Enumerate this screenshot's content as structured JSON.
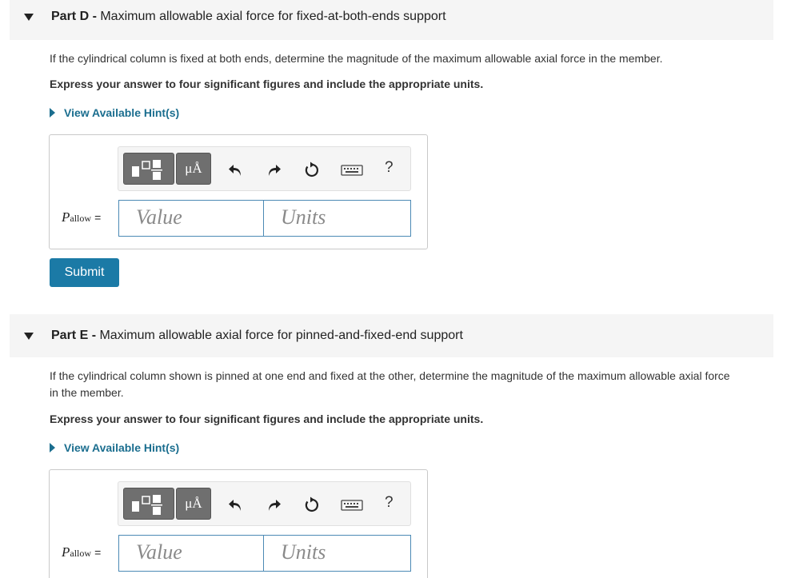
{
  "part_d": {
    "label": "Part D",
    "separator": " - ",
    "title": "Maximum allowable axial force for fixed-at-both-ends support",
    "question": "If the cylindrical column is fixed at both ends, determine the magnitude of the maximum allowable axial force in the member.",
    "instruction": "Express your answer to four significant figures and include the appropriate units.",
    "hint": "View Available Hint(s)",
    "toolbar": {
      "units_symbol": "μÅ",
      "help": "?"
    },
    "variable": {
      "symbol": "P",
      "subscript": "allow",
      "equals": "="
    },
    "value_placeholder": "Value",
    "units_placeholder": "Units",
    "submit": "Submit"
  },
  "part_e": {
    "label": "Part E",
    "separator": " - ",
    "title": "Maximum allowable axial force for pinned-and-fixed-end support",
    "question": "If the cylindrical column shown is pinned at one end and fixed at the other, determine the magnitude of the maximum allowable axial force in the member.",
    "instruction": "Express your answer to four significant figures and include the appropriate units.",
    "hint": "View Available Hint(s)",
    "toolbar": {
      "units_symbol": "μÅ",
      "help": "?"
    },
    "variable": {
      "symbol": "P",
      "subscript": "allow",
      "equals": "="
    },
    "value_placeholder": "Value",
    "units_placeholder": "Units"
  }
}
